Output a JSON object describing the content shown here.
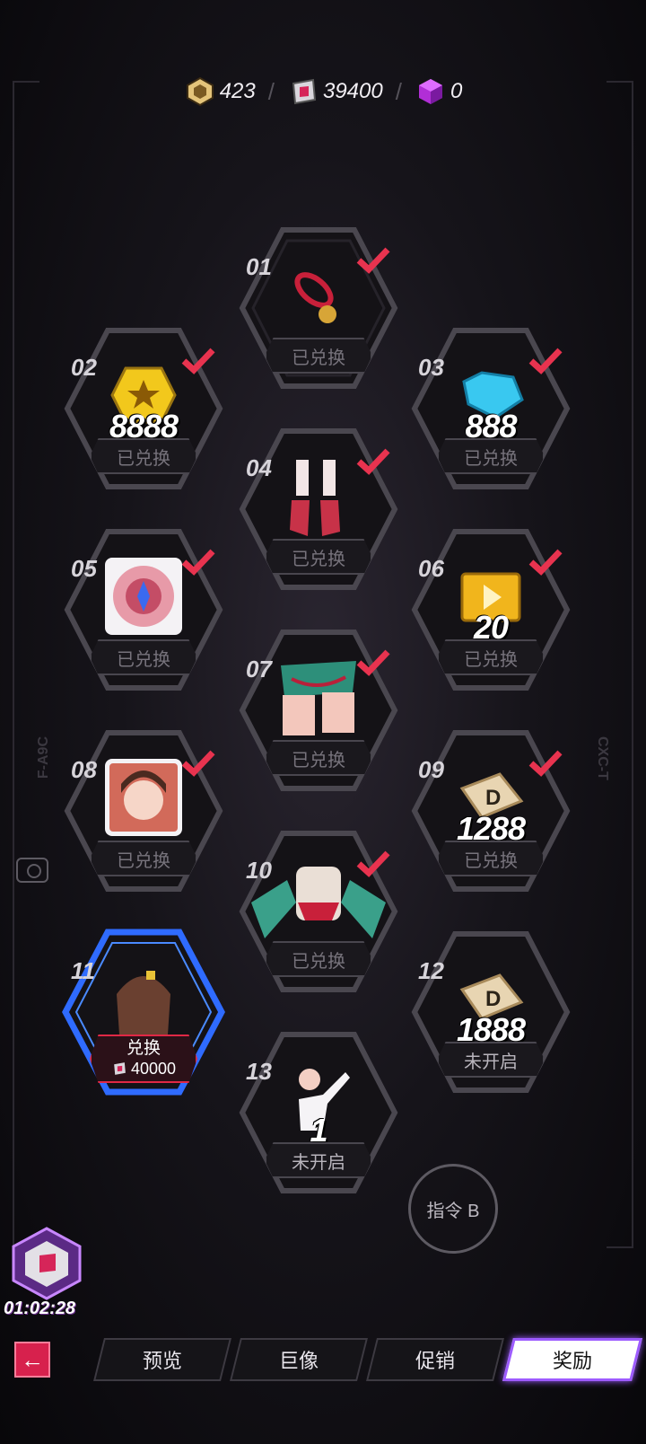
{
  "currency": [
    {
      "icon": "gold-hex-coin-icon",
      "value": "423"
    },
    {
      "icon": "pink-gem-icon",
      "value": "39400"
    },
    {
      "icon": "purple-cube-icon",
      "value": "0"
    }
  ],
  "side_labels": {
    "left": "F-A9C",
    "right": "CXC-T"
  },
  "nodes": [
    {
      "num": "01",
      "status": "已兑换",
      "art": "red-ring-bell-icon",
      "qty": "",
      "claimed": true
    },
    {
      "num": "02",
      "status": "已兑换",
      "art": "gold-badge-icon",
      "qty": "8888",
      "claimed": true
    },
    {
      "num": "03",
      "status": "已兑换",
      "art": "blue-crystal-icon",
      "qty": "888",
      "claimed": true
    },
    {
      "num": "04",
      "status": "已兑换",
      "art": "shoes-icon",
      "qty": "",
      "claimed": true
    },
    {
      "num": "05",
      "status": "已兑换",
      "art": "eye-avatar-icon",
      "qty": "",
      "claimed": true
    },
    {
      "num": "06",
      "status": "已兑换",
      "art": "gold-video-box-icon",
      "qty": "20",
      "claimed": true
    },
    {
      "num": "07",
      "status": "已兑换",
      "art": "skirt-outfit-icon",
      "qty": "",
      "claimed": true
    },
    {
      "num": "08",
      "status": "已兑换",
      "art": "character-portrait-icon",
      "qty": "",
      "claimed": true
    },
    {
      "num": "09",
      "status": "已兑换",
      "art": "ticket-d-icon",
      "qty": "1288",
      "claimed": true
    },
    {
      "num": "10",
      "status": "已兑换",
      "art": "top-outfit-icon",
      "qty": "",
      "claimed": true
    },
    {
      "num": "11",
      "status": "兑换",
      "art": "hair-icon",
      "qty": "",
      "claimed": false,
      "price": "40000"
    },
    {
      "num": "12",
      "status": "未开启",
      "art": "ticket-d-icon",
      "qty": "1888",
      "claimed": false
    },
    {
      "num": "13",
      "status": "未开启",
      "art": "pose-icon",
      "qty": "1",
      "claimed": false
    }
  ],
  "command_button": "指令 B",
  "timer": "01:02:28",
  "tabs": [
    {
      "label": "预览",
      "active": false
    },
    {
      "label": "巨像",
      "active": false
    },
    {
      "label": "促销",
      "active": false
    },
    {
      "label": "奖励",
      "active": true
    }
  ],
  "colors": {
    "accent": "#e02845",
    "active_tab_border": "#9d5bff",
    "check": "#e8334f",
    "hex_border": "#4a474f"
  }
}
